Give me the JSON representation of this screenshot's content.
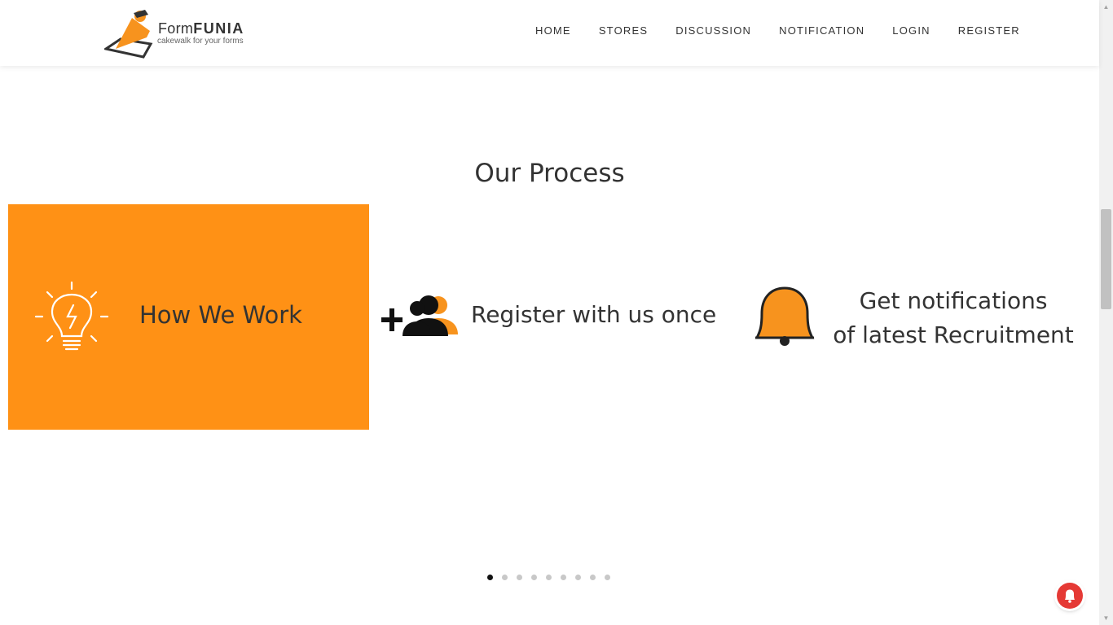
{
  "brand": {
    "name_light": "Form",
    "name_bold": "FUNIA",
    "tagline": "cakewalk for your forms"
  },
  "nav": {
    "items": [
      "HOME",
      "STORES",
      "DISCUSSION",
      "NOTIFICATION",
      "LOGIN",
      "REGISTER"
    ]
  },
  "process": {
    "title": "Our Process",
    "slides": [
      {
        "text": "How We Work",
        "icon": "lightbulb-icon"
      },
      {
        "text": "Register with us once",
        "icon": "add-users-icon"
      },
      {
        "text_line1": "Get notifications",
        "text_line2": "of latest Recruitment",
        "icon": "bell-icon"
      }
    ],
    "dot_count": 9,
    "active_dot": 1
  },
  "colors": {
    "accent": "#ff9115",
    "notification": "#e53935"
  }
}
